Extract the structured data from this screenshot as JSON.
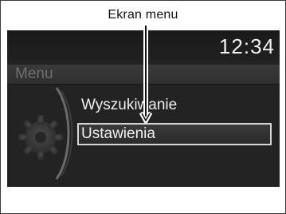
{
  "caption": "Ekran menu",
  "status": {
    "clock": "12:34"
  },
  "menu": {
    "header": "Menu",
    "items": [
      {
        "label": "Wyszukiwanie",
        "selected": false
      },
      {
        "label": "Ustawienia",
        "selected": true
      }
    ]
  },
  "colors": {
    "screen_bg": "#232323",
    "header_text": "#6e6e6e",
    "item_text": "#f0f0f0",
    "selection_border": "#d6d6d6"
  },
  "icons": {
    "decorative": "gear-icon"
  }
}
